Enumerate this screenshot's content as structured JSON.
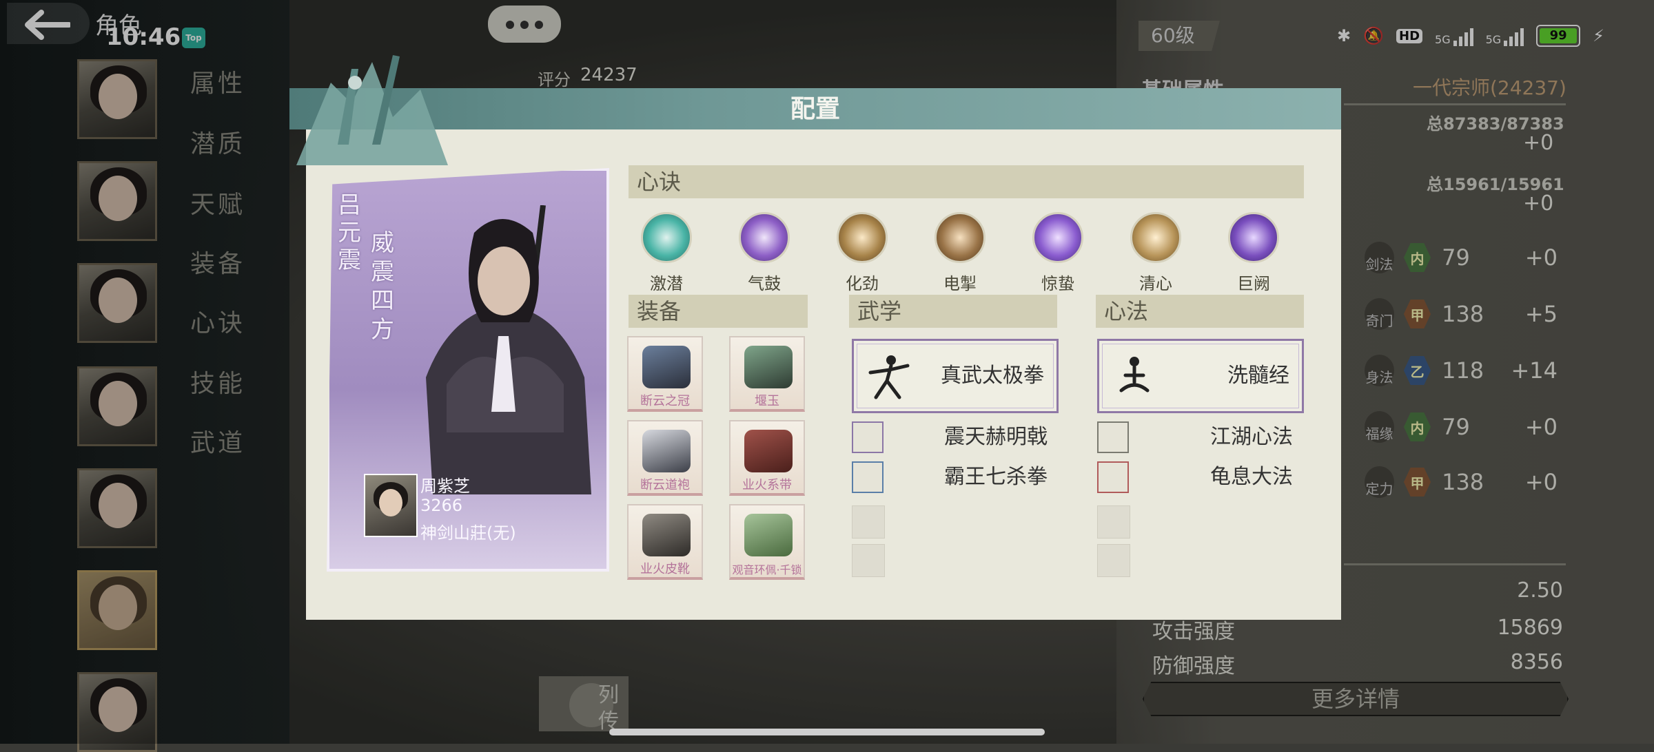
{
  "status_bar": {
    "page_title": "角色",
    "time": "10:46",
    "badge": "Top",
    "hd_label": "HD",
    "net_1": "5G",
    "net_2": "5G",
    "battery": "99"
  },
  "sidebar": {
    "tabs": [
      "属性",
      "潜质",
      "天赋",
      "装备",
      "心诀",
      "技能",
      "武道"
    ]
  },
  "score": {
    "label": "评分",
    "value": "24237"
  },
  "right_panel": {
    "level": "60级",
    "basic_attr": "基础属性",
    "rating": "一代宗师(24237)",
    "total_1": "总87383/87383",
    "plus_1": "+0",
    "total_2": "总15961/15961",
    "plus_2": "+0",
    "stats": [
      {
        "icon": "剑法",
        "tag": "内",
        "value": "79",
        "delta": "+0"
      },
      {
        "icon": "奇门",
        "tag": "甲",
        "value": "138",
        "delta": "+5"
      },
      {
        "icon": "身法",
        "tag": "乙",
        "value": "118",
        "delta": "+14"
      },
      {
        "icon": "福缘",
        "tag": "内",
        "value": "79",
        "delta": "+0"
      },
      {
        "icon": "定力",
        "tag": "甲",
        "value": "138",
        "delta": "+0"
      }
    ],
    "extra_value": "2.50",
    "attack_label": "攻击强度",
    "attack_value": "15869",
    "defense_label": "防御强度",
    "defense_value": "8356",
    "more_details": "更多详情"
  },
  "bottom": {
    "biography_line1": "列",
    "biography_line2": "传"
  },
  "dialog": {
    "title": "配置",
    "character": {
      "name": "吕元震",
      "title": "威震四方",
      "partner_name": "周紫芝",
      "partner_value": "3266",
      "partner_sect": "神剑山莊(无)"
    },
    "xinjue": {
      "header": "心诀",
      "skills": [
        {
          "label": "激潜",
          "color": "#49b4a6"
        },
        {
          "label": "气鼓",
          "color": "#8d5fc6"
        },
        {
          "label": "化劲",
          "color": "#a8844a"
        },
        {
          "label": "电掣",
          "color": "#9a7448"
        },
        {
          "label": "惊蛰",
          "color": "#8a5ccf"
        },
        {
          "label": "清心",
          "color": "#b8955a"
        },
        {
          "label": "巨阙",
          "color": "#7a4fbe"
        }
      ]
    },
    "equipment": {
      "header": "装备",
      "items": [
        "断云之冠",
        "堰玉",
        "断云道袍",
        "业火系带",
        "业火皮靴",
        "观音环佩·千锁"
      ]
    },
    "wuxue": {
      "header": "武学",
      "main": "真武太极拳",
      "subs": [
        "震天赫明戟",
        "霸王七杀拳"
      ]
    },
    "xinfa": {
      "header": "心法",
      "main": "洗髓经",
      "subs": [
        "江湖心法",
        "龟息大法"
      ]
    }
  }
}
